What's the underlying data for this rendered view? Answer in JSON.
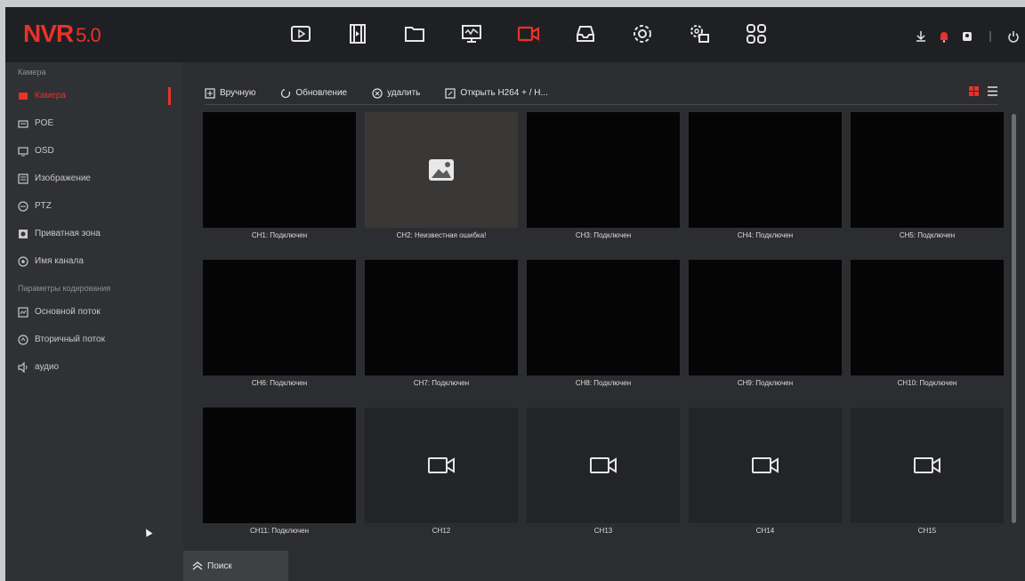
{
  "header": {
    "logo": "NVR",
    "version": "5.0",
    "nav_icons": [
      "playback-icon",
      "video-clip-icon",
      "folder-icon",
      "monitor-icon",
      "camera-icon",
      "storage-icon",
      "settings-icon",
      "system-settings-icon",
      "apps-grid-icon"
    ],
    "active_nav": "camera-icon",
    "right_icons": [
      "download-icon",
      "alarm-bell-icon",
      "user-icon",
      "power-icon"
    ]
  },
  "sidebar": {
    "group1": "Камера",
    "items1": [
      {
        "label": "Камера",
        "icon": "camera-icon",
        "active": true
      },
      {
        "label": "POE",
        "icon": "poe-icon"
      },
      {
        "label": "OSD",
        "icon": "osd-icon"
      },
      {
        "label": "Изображение",
        "icon": "image-icon"
      },
      {
        "label": "PTZ",
        "icon": "ptz-icon"
      },
      {
        "label": "Приватная зона",
        "icon": "privacy-icon"
      },
      {
        "label": "Имя канала",
        "icon": "channel-name-icon"
      }
    ],
    "group2": "Параметры кодирования",
    "items2": [
      {
        "label": "Основной поток",
        "icon": "main-stream-icon"
      },
      {
        "label": "Вторичный поток",
        "icon": "sub-stream-icon"
      },
      {
        "label": "аудио",
        "icon": "audio-icon"
      }
    ]
  },
  "toolbar": {
    "manual": "Вручную",
    "refresh": "Обновление",
    "delete": "удалить",
    "open_h264": "Открыть H264 + / H..."
  },
  "channels": [
    {
      "label": "CH1: Подключен",
      "state": "connected"
    },
    {
      "label": "CH2: Неизвестная ошибка!",
      "state": "error"
    },
    {
      "label": "CH3: Подключен",
      "state": "connected"
    },
    {
      "label": "CH4: Подключен",
      "state": "connected"
    },
    {
      "label": "CH5: Подключен",
      "state": "connected"
    },
    {
      "label": "CH6: Подключен",
      "state": "connected"
    },
    {
      "label": "CH7: Подключен",
      "state": "connected"
    },
    {
      "label": "CH8: Подключен",
      "state": "connected"
    },
    {
      "label": "CH9: Подключен",
      "state": "connected"
    },
    {
      "label": "CH10: Подключен",
      "state": "connected"
    },
    {
      "label": "CH11: Подключен",
      "state": "connected"
    },
    {
      "label": "CH12",
      "state": "empty"
    },
    {
      "label": "CH13",
      "state": "empty"
    },
    {
      "label": "CH14",
      "state": "empty"
    },
    {
      "label": "CH15",
      "state": "empty"
    }
  ],
  "search_tab": "Поиск",
  "colors": {
    "accent": "#e8322b",
    "background": "#2c2d30"
  }
}
